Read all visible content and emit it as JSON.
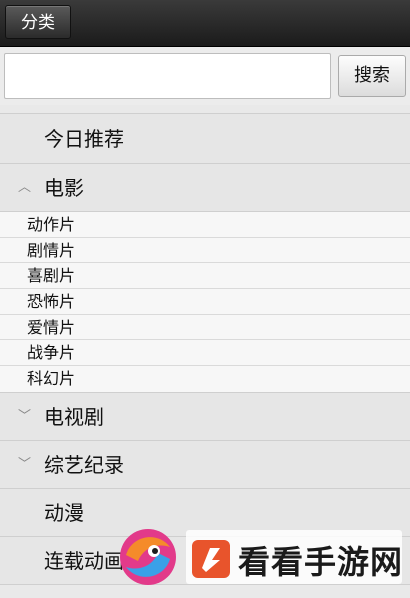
{
  "topbar": {
    "category_label": "分类"
  },
  "search": {
    "value": "",
    "placeholder": "",
    "button_label": "搜索"
  },
  "menu": {
    "items": [
      {
        "label": "今日推荐"
      },
      {
        "label": "电影",
        "expanded": true,
        "children": [
          "动作片",
          "剧情片",
          "喜剧片",
          "恐怖片",
          "爱情片",
          "战争片",
          "科幻片"
        ]
      },
      {
        "label": "电视剧",
        "expanded": false
      },
      {
        "label": "综艺纪录",
        "expanded": false
      },
      {
        "label": "动漫"
      },
      {
        "label": "连载动画"
      }
    ]
  },
  "icons": {
    "expanded": "chevron-up-icon",
    "collapsed": "chevron-down-icon"
  },
  "watermark": {
    "text": "看看手游网"
  }
}
